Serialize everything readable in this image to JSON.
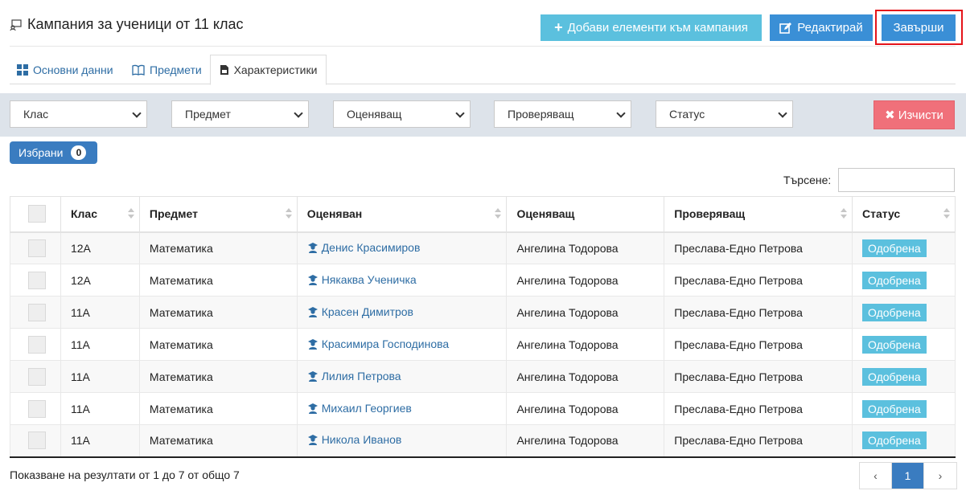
{
  "header": {
    "title": "Кампания за ученици от 11 клас",
    "add_label": "Добави елементи към кампания",
    "edit_label": "Редактирай",
    "finish_label": "Завърши"
  },
  "tabs": [
    {
      "label": "Основни данни"
    },
    {
      "label": "Предмети"
    },
    {
      "label": "Характеристики"
    }
  ],
  "filters": {
    "class": "Клас",
    "subject": "Предмет",
    "grader": "Оценяващ",
    "checker": "Проверяващ",
    "status": "Статус",
    "clear_label": "Изчисти"
  },
  "selected": {
    "label": "Избрани",
    "count": "0"
  },
  "search": {
    "label": "Търсене:",
    "value": ""
  },
  "table": {
    "headers": [
      "Клас",
      "Предмет",
      "Оценяван",
      "Оценяващ",
      "Проверяващ",
      "Статус"
    ],
    "rows": [
      {
        "class": "12А",
        "subject": "Математика",
        "student": "Денис Красимиров",
        "grader": "Ангелина Тодорова",
        "checker": "Преслава-Едно Петрова",
        "status": "Одобрена"
      },
      {
        "class": "12А",
        "subject": "Математика",
        "student": "Някаква Ученичка",
        "grader": "Ангелина Тодорова",
        "checker": "Преслава-Едно Петрова",
        "status": "Одобрена"
      },
      {
        "class": "11А",
        "subject": "Математика",
        "student": "Красен Димитров",
        "grader": "Ангелина Тодорова",
        "checker": "Преслава-Едно Петрова",
        "status": "Одобрена"
      },
      {
        "class": "11А",
        "subject": "Математика",
        "student": "Красимира Господинова",
        "grader": "Ангелина Тодорова",
        "checker": "Преслава-Едно Петрова",
        "status": "Одобрена"
      },
      {
        "class": "11А",
        "subject": "Математика",
        "student": "Лилия Петрова",
        "grader": "Ангелина Тодорова",
        "checker": "Преслава-Едно Петрова",
        "status": "Одобрена"
      },
      {
        "class": "11А",
        "subject": "Математика",
        "student": "Михаил Георгиев",
        "grader": "Ангелина Тодорова",
        "checker": "Преслава-Едно Петрова",
        "status": "Одобрена"
      },
      {
        "class": "11А",
        "subject": "Математика",
        "student": "Никола Иванов",
        "grader": "Ангелина Тодорова",
        "checker": "Преслава-Едно Петрова",
        "status": "Одобрена"
      }
    ]
  },
  "footer": {
    "info": "Показване на резултати от 1 до 7 от общо 7"
  },
  "pagination": {
    "prev": "‹",
    "current": "1",
    "next": "›"
  },
  "colors": {
    "primary": "#3a8fd6",
    "info": "#5bc0de",
    "danger": "#f0707a",
    "highlight": "#e5141a"
  }
}
